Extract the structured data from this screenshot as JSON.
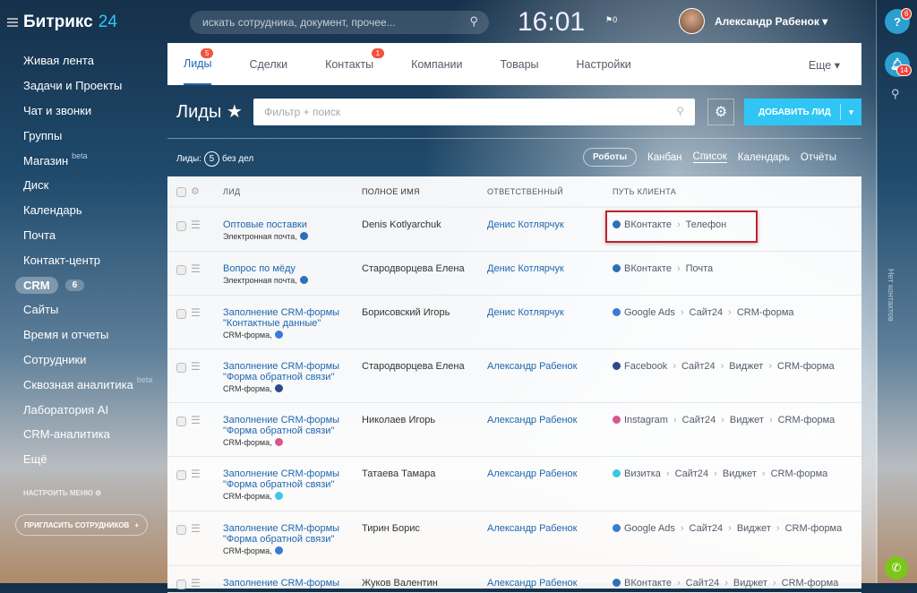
{
  "logo": {
    "name": "Битрикс",
    "num": "24"
  },
  "sidebar": {
    "items": [
      {
        "label": "Живая лента"
      },
      {
        "label": "Задачи и Проекты"
      },
      {
        "label": "Чат и звонки"
      },
      {
        "label": "Группы"
      },
      {
        "label": "Магазин",
        "sup": "beta"
      },
      {
        "label": "Диск"
      },
      {
        "label": "Календарь"
      },
      {
        "label": "Почта"
      },
      {
        "label": "Контакт-центр"
      },
      {
        "label": "CRM",
        "count": "6"
      },
      {
        "label": "Сайты"
      },
      {
        "label": "Время и отчеты"
      },
      {
        "label": "Сотрудники"
      },
      {
        "label": "Сквозная аналитика",
        "sup": "beta"
      },
      {
        "label": "Лаборатория AI"
      },
      {
        "label": "CRM-аналитика"
      },
      {
        "label": "Ещё"
      }
    ],
    "configure": "НАСТРОИТЬ МЕНЮ",
    "invite": "ПРИГЛАСИТЬ СОТРУДНИКОВ"
  },
  "header": {
    "search_placeholder": "искать сотрудника, документ, прочее...",
    "time": "16:01",
    "flag_count": "0",
    "user": "Александр Рабенок"
  },
  "rightbar": {
    "help_badge": "6",
    "notif_badge": "14",
    "no_contacts": "Нет контактов"
  },
  "tabs": [
    {
      "label": "Лиды",
      "badge": "5"
    },
    {
      "label": "Сделки"
    },
    {
      "label": "Контакты",
      "badge": "1"
    },
    {
      "label": "Компании"
    },
    {
      "label": "Товары"
    },
    {
      "label": "Настройки"
    }
  ],
  "more": "Еще",
  "page": {
    "title": "Лиды",
    "filter_placeholder": "Фильтр + поиск",
    "add": "ДОБАВИТЬ ЛИД",
    "counter_label": "Лиды:",
    "counter": "5",
    "counter_suffix": "без дел"
  },
  "views": {
    "robots": "Роботы",
    "items": [
      "Канбан",
      "Список",
      "Календарь",
      "Отчёты"
    ]
  },
  "table": {
    "headers": [
      "ЛИД",
      "ПОЛНОЕ ИМЯ",
      "ОТВЕТСТВЕННЫЙ",
      "ПУТЬ КЛИЕНТА"
    ],
    "rows": [
      {
        "lead": "Оптовые поставки",
        "source": "Электронная почта,",
        "name": "Denis Kotlyarchuk",
        "resp": "Денис Котлярчук",
        "path": [
          "ВКонтакте",
          "Телефон"
        ],
        "color": "#2f6fb5"
      },
      {
        "lead": "Вопрос по мёду",
        "source": "Электронная почта,",
        "name": "Стародворцева Елена",
        "resp": "Денис Котлярчук",
        "path": [
          "ВКонтакте",
          "Почта"
        ],
        "color": "#2f6fb5"
      },
      {
        "lead": "Заполнение CRM-формы \"Контактные данные\"",
        "source": "CRM-форма,",
        "name": "Борисовский Игорь",
        "resp": "Денис Котлярчук",
        "path": [
          "Google Ads",
          "Сайт24",
          "CRM-форма"
        ],
        "color": "#3a7bd5"
      },
      {
        "lead": "Заполнение CRM-формы \"Форма обратной связи\"",
        "source": "CRM-форма,",
        "name": "Стародворцева Елена",
        "resp": "Александр Рабенок",
        "path": [
          "Facebook",
          "Сайт24",
          "Виджет",
          "CRM-форма"
        ],
        "color": "#2d4a8a"
      },
      {
        "lead": "Заполнение CRM-формы \"Форма обратной связи\"",
        "source": "CRM-форма,",
        "name": "Николаев Игорь",
        "resp": "Александр Рабенок",
        "path": [
          "Instagram",
          "Сайт24",
          "Виджет",
          "CRM-форма"
        ],
        "color": "#d9578f"
      },
      {
        "lead": "Заполнение CRM-формы \"Форма обратной связи\"",
        "source": "CRM-форма,",
        "name": "Татаева Тамара",
        "resp": "Александр Рабенок",
        "path": [
          "Визитка",
          "Сайт24",
          "Виджет",
          "CRM-форма"
        ],
        "color": "#3cc8e0"
      },
      {
        "lead": "Заполнение CRM-формы \"Форма обратной связи\"",
        "source": "CRM-форма,",
        "name": "Тирин Борис",
        "resp": "Александр Рабенок",
        "path": [
          "Google Ads",
          "Сайт24",
          "Виджет",
          "CRM-форма"
        ],
        "color": "#3a7bd5"
      },
      {
        "lead": "Заполнение CRM-формы",
        "source": "",
        "name": "Жуков Валентин",
        "resp": "Александр Рабенок",
        "path": [
          "ВКонтакте",
          "Сайт24",
          "Виджет",
          "CRM-форма"
        ],
        "color": "#2f6fb5"
      }
    ]
  }
}
